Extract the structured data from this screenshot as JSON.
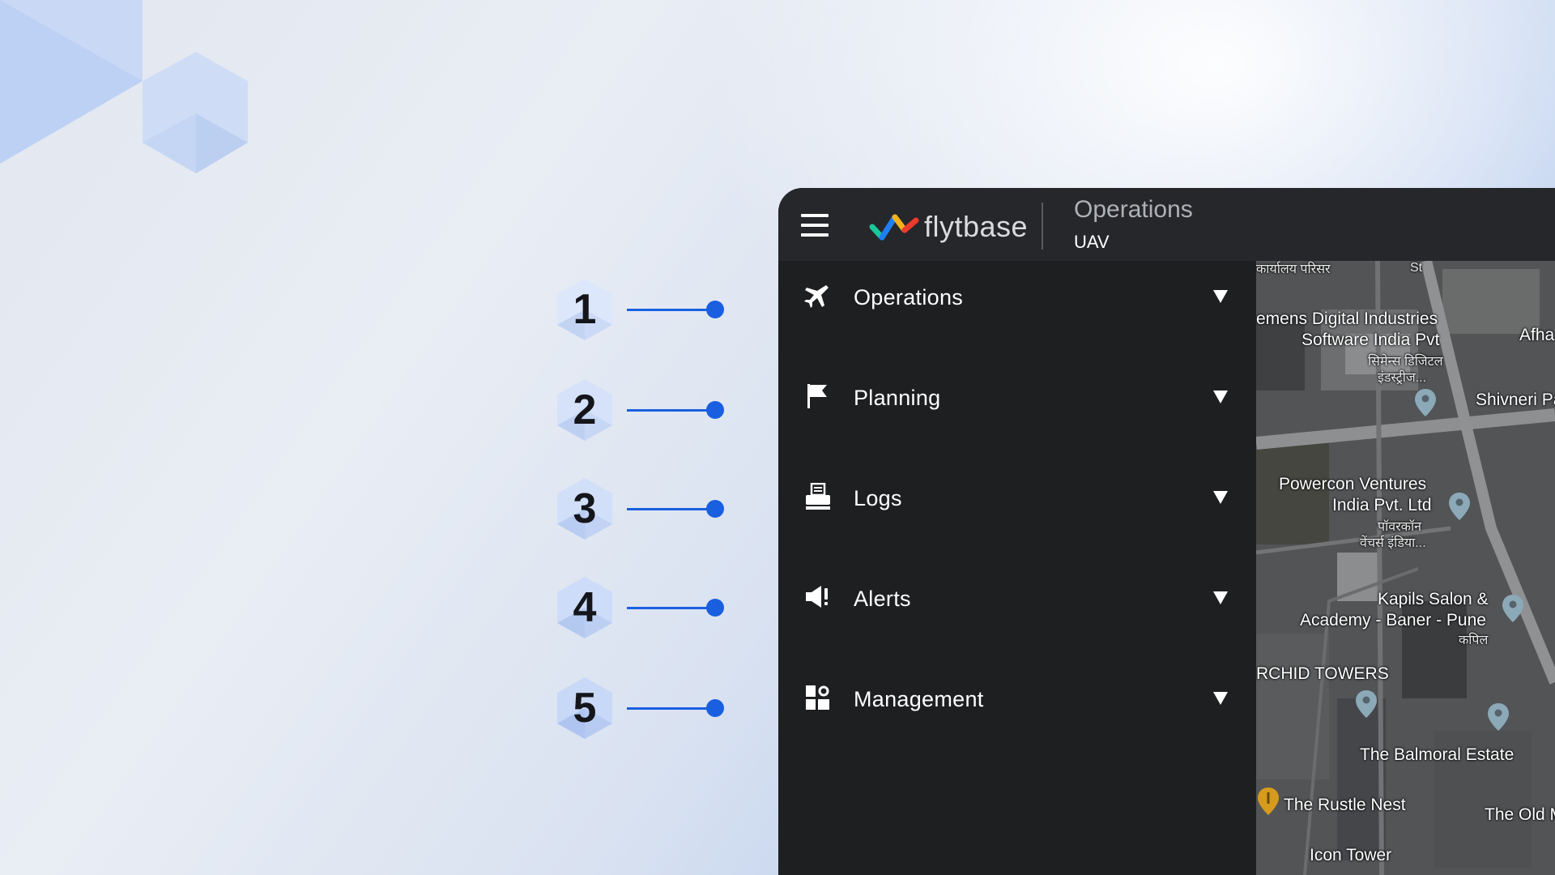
{
  "steps": [
    {
      "number": "1"
    },
    {
      "number": "2"
    },
    {
      "number": "3"
    },
    {
      "number": "4"
    },
    {
      "number": "5"
    }
  ],
  "app": {
    "brand": "flytbase",
    "context_title": "Operations",
    "context_subtitle": "UAV",
    "menu": [
      {
        "label": "Operations",
        "icon": "airplane-icon"
      },
      {
        "label": "Planning",
        "icon": "flag-icon"
      },
      {
        "label": "Logs",
        "icon": "printer-icon"
      },
      {
        "label": "Alerts",
        "icon": "megaphone-icon"
      },
      {
        "label": "Management",
        "icon": "dashboard-icon"
      }
    ]
  },
  "map": {
    "labels": [
      "कार्यालय परिसर",
      "emens Digital Industries",
      "Software India Pvt",
      "सिमेन्स डिजिटल",
      "इंडस्ट्रीज...",
      "Afha",
      "Shivneri Pa",
      "Powercon Ventures",
      "India Pvt. Ltd",
      "पॉवरकॉन",
      "वेंचर्स इंडिया...",
      "Kapils Salon &",
      "Academy - Baner - Pune",
      "कपिल",
      "RCHID TOWERS",
      "The Balmoral Estate",
      "The Rustle Nest",
      "The Old M",
      "Icon Tower",
      "St"
    ]
  },
  "colors": {
    "accent": "#1a5fe0",
    "sidebar_bg": "#1e1f21",
    "topbar_bg": "#26272a"
  }
}
